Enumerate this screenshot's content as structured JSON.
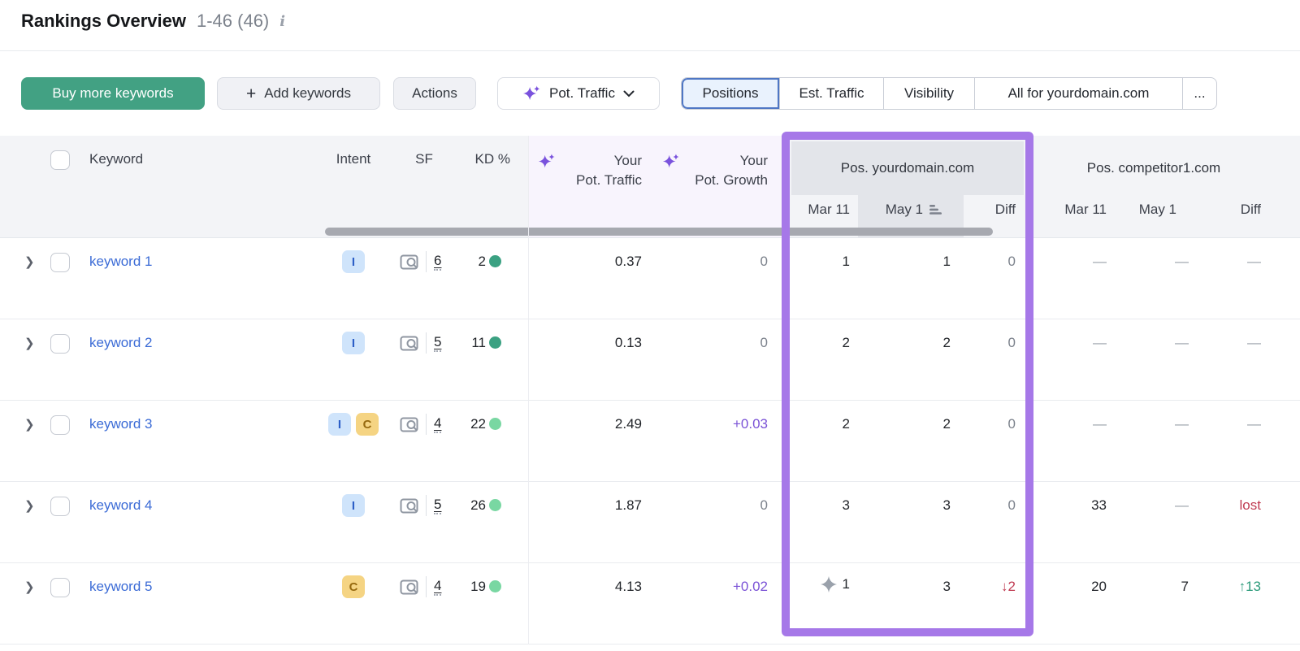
{
  "page": {
    "title": "Rankings Overview",
    "count": "1-46 (46)"
  },
  "toolbar": {
    "buy_label": "Buy more keywords",
    "add_label": "Add keywords",
    "plus": "+",
    "actions_label": "Actions",
    "metric_dropdown": "Pot. Traffic",
    "tabs": [
      {
        "label": "Positions",
        "selected": true
      },
      {
        "label": "Est. Traffic",
        "selected": false
      },
      {
        "label": "Visibility",
        "selected": false
      },
      {
        "label": "All for yourdomain.com",
        "selected": false
      },
      {
        "label": "...",
        "selected": false
      }
    ]
  },
  "table": {
    "header": {
      "keyword": "Keyword",
      "intent": "Intent",
      "sf": "SF",
      "kd": "KD %",
      "pot_traffic_l1": "Your",
      "pot_traffic_l2": "Pot. Traffic",
      "pot_growth_l1": "Your",
      "pot_growth_l2": "Pot. Growth",
      "group_your": "Pos. yourdomain.com",
      "group_comp": "Pos. competitor1.com",
      "sub_mar": "Mar 11",
      "sub_may": "May 1",
      "sub_diff": "Diff",
      "sorted_column": "May 1"
    },
    "rows": [
      {
        "keyword": "keyword 1",
        "intents": [
          {
            "label": "I"
          }
        ],
        "sf": "6",
        "kd": "2",
        "kd_color": "#3ba182",
        "pot_traffic": "0.37",
        "pot_growth": "0",
        "your_mar": "1",
        "your_may": "1",
        "your_diff": "0",
        "comp_mar": "—",
        "comp_may": "—",
        "comp_diff": "—"
      },
      {
        "keyword": "keyword 2",
        "intents": [
          {
            "label": "I"
          }
        ],
        "sf": "5",
        "kd": "11",
        "kd_color": "#3ba182",
        "pot_traffic": "0.13",
        "pot_growth": "0",
        "your_mar": "2",
        "your_may": "2",
        "your_diff": "0",
        "comp_mar": "—",
        "comp_may": "—",
        "comp_diff": "—"
      },
      {
        "keyword": "keyword 3",
        "intents": [
          {
            "label": "I"
          },
          {
            "label": "C"
          }
        ],
        "sf": "4",
        "kd": "22",
        "kd_color": "#79d7a2",
        "pot_traffic": "2.49",
        "pot_growth": "+0.03",
        "your_mar": "2",
        "your_may": "2",
        "your_diff": "0",
        "comp_mar": "—",
        "comp_may": "—",
        "comp_diff": "—"
      },
      {
        "keyword": "keyword 4",
        "intents": [
          {
            "label": "I"
          }
        ],
        "sf": "5",
        "kd": "26",
        "kd_color": "#79d7a2",
        "pot_traffic": "1.87",
        "pot_growth": "0",
        "your_mar": "3",
        "your_may": "3",
        "your_diff": "0",
        "comp_mar": "33",
        "comp_may": "—",
        "comp_diff": "lost"
      },
      {
        "keyword": "keyword 5",
        "intents": [
          {
            "label": "C"
          }
        ],
        "sf": "4",
        "kd": "19",
        "kd_color": "#79d7a2",
        "pot_traffic": "4.13",
        "pot_growth": "+0.02",
        "your_mar": "1",
        "your_mar_icon": "serp-feature-star",
        "your_may": "3",
        "your_diff": "↓2",
        "comp_mar": "20",
        "comp_may": "7",
        "comp_diff": "↑13"
      }
    ]
  },
  "colors": {
    "accent-green": "#42a183",
    "highlight-purple": "#a678e8",
    "link-blue": "#3b6bd6",
    "growth-purple": "#7a52d6",
    "red": "#c03b52",
    "green": "#2b9a7a",
    "kd-dark-green": "#3ba182",
    "kd-light-green": "#79d7a2",
    "intent-info-bg": "#cfe4fb",
    "intent-info-text": "#2c5fc7",
    "intent-comm-bg": "#f5d483",
    "intent-comm-text": "#96690f",
    "tab-selected-bg": "#e9f2fd",
    "tab-selected-border": "#4f77c4"
  }
}
